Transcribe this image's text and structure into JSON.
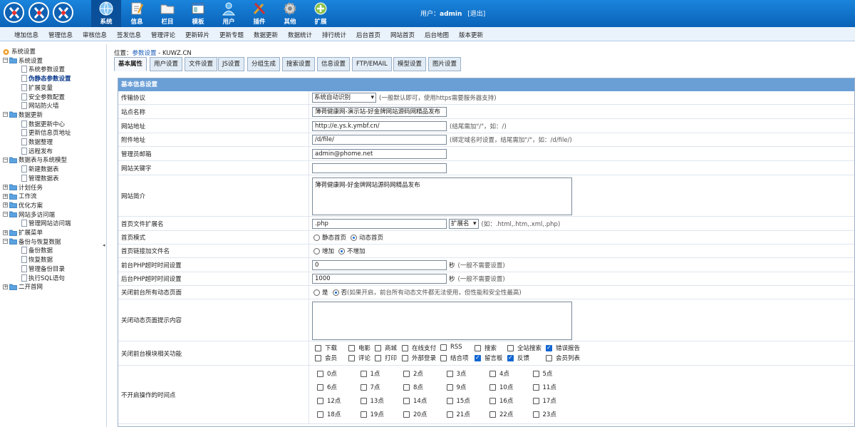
{
  "header": {
    "modules": [
      {
        "label": "系统",
        "icon": "globe-icon",
        "active": true
      },
      {
        "label": "信息",
        "icon": "document-pen-icon"
      },
      {
        "label": "栏目",
        "icon": "folder-icon"
      },
      {
        "label": "模板",
        "icon": "template-window-icon"
      },
      {
        "label": "用户",
        "icon": "user-icon"
      },
      {
        "label": "插件",
        "icon": "tools-icon"
      },
      {
        "label": "其他",
        "icon": "gear-icon"
      },
      {
        "label": "扩展",
        "icon": "plus-circle-icon"
      }
    ],
    "user_prefix": "用户：",
    "username": "admin",
    "logout": "[退出]"
  },
  "menu": [
    "增加信息",
    "管理信息",
    "审核信息",
    "签发信息",
    "管理评论",
    "更新碎片",
    "更新专题",
    "数据更新",
    "数据统计",
    "排行统计",
    "后台首页",
    "网站首页",
    "后台地图",
    "版本更新"
  ],
  "sidebar": {
    "nodes": [
      {
        "label": "系统设置",
        "level": 0,
        "type": "root"
      },
      {
        "label": "系统设置",
        "level": 1,
        "type": "folder"
      },
      {
        "label": "系统参数设置",
        "level": 2,
        "type": "page"
      },
      {
        "label": "伪静态参数设置",
        "level": 2,
        "type": "page",
        "current": true
      },
      {
        "label": "扩展变量",
        "level": 2,
        "type": "page"
      },
      {
        "label": "安全参数配置",
        "level": 2,
        "type": "page"
      },
      {
        "label": "网站防火墙",
        "level": 2,
        "type": "page"
      },
      {
        "label": "数据更新",
        "level": 1,
        "type": "folder"
      },
      {
        "label": "数据更新中心",
        "level": 2,
        "type": "page"
      },
      {
        "label": "更新信息页地址",
        "level": 2,
        "type": "page"
      },
      {
        "label": "数据整理",
        "level": 2,
        "type": "page"
      },
      {
        "label": "远程发布",
        "level": 2,
        "type": "page"
      },
      {
        "label": "数据表与系统模型",
        "level": 1,
        "type": "folder"
      },
      {
        "label": "新建数据表",
        "level": 2,
        "type": "page"
      },
      {
        "label": "管理数据表",
        "level": 2,
        "type": "page"
      },
      {
        "label": "计划任务",
        "level": 1,
        "type": "folder-closed"
      },
      {
        "label": "工作流",
        "level": 1,
        "type": "folder-closed"
      },
      {
        "label": "优化方案",
        "level": 1,
        "type": "folder-closed"
      },
      {
        "label": "网站多访问端",
        "level": 1,
        "type": "folder"
      },
      {
        "label": "管理网站访问端",
        "level": 2,
        "type": "page"
      },
      {
        "label": "扩展菜单",
        "level": 1,
        "type": "folder-closed"
      },
      {
        "label": "备份与恢复数据",
        "level": 1,
        "type": "folder"
      },
      {
        "label": "备份数据",
        "level": 2,
        "type": "page"
      },
      {
        "label": "恢复数据",
        "level": 2,
        "type": "page"
      },
      {
        "label": "管理备份目录",
        "level": 2,
        "type": "page"
      },
      {
        "label": "执行SQL语句",
        "level": 2,
        "type": "page"
      },
      {
        "label": "二开首网",
        "level": 1,
        "type": "folder-closed"
      }
    ],
    "collapse_glyph": "◂"
  },
  "breadcrumb": {
    "prefix": "位置：",
    "link": "参数设置",
    "suffix": " - KUWZ.CN"
  },
  "tabs": [
    "基本属性",
    "用户设置",
    "文件设置",
    "JS设置",
    "分组生成",
    "搜索设置",
    "信息设置",
    "FTP/EMAIL",
    "模型设置",
    "图片设置"
  ],
  "form": {
    "section_title": "基本信息设置",
    "protocol": {
      "label": "传输协议",
      "value": "系统自动识别",
      "hint": "(一般默认即可，使用https需要服务器支持)"
    },
    "sitename": {
      "label": "站点名称",
      "value": "薄荷健康网-演示站-好金牌网站源码网精品发布"
    },
    "siteurl": {
      "label": "网站地址",
      "value": "http://e.ys.k.ymbf.cn/",
      "hint": "(结尾需加\"/\"，如：/)"
    },
    "attach": {
      "label": "附件地址",
      "value": "/d/file/",
      "hint": "(绑定域名时设置，结尾需加\"/\"，如：/d/file/)"
    },
    "email": {
      "label": "管理员邮箱",
      "value": "admin@phome.net"
    },
    "keywords": {
      "label": "网站关键字",
      "value": ""
    },
    "intro": {
      "label": "网站简介",
      "value": "薄荷健康网-好金牌网站源码网精品发布"
    },
    "ext": {
      "label": "首页文件扩展名",
      "value": ".php",
      "select": "扩展名",
      "hint": "(如：.html,.htm,.xml,.php)"
    },
    "homemode": {
      "label": "首页模式",
      "opt1": "静态首页",
      "opt2": "动态首页"
    },
    "homelink": {
      "label": "首页链接加文件名",
      "opt1": "增加",
      "opt2": "不增加"
    },
    "fronttimeout": {
      "label": "前台PHP超时时间设置",
      "value": "0",
      "unit": "秒",
      "hint": "(一般不需要设置)"
    },
    "backtimeout": {
      "label": "后台PHP超时时间设置",
      "value": "1000",
      "unit": "秒",
      "hint": "(一般不需要设置)"
    },
    "closedyn": {
      "label": "关闭前台所有动态页面",
      "opt1": "是",
      "opt2": "否",
      "hint": "(如果开启，前台所有动态文件都无法使用，但性能和安全性最高)"
    },
    "closetip": {
      "label": "关闭动态页面提示内容",
      "value": ""
    },
    "modules": {
      "label": "关闭前台模块相关功能",
      "items": [
        {
          "label": "下载",
          "checked": false
        },
        {
          "label": "电影",
          "checked": false
        },
        {
          "label": "商城",
          "checked": false
        },
        {
          "label": "在线支付",
          "checked": false
        },
        {
          "label": "RSS",
          "checked": false
        },
        {
          "label": "搜索",
          "checked": false
        },
        {
          "label": "全站搜索",
          "checked": false
        },
        {
          "label": "错误报告",
          "checked": true
        },
        {
          "label": "会员",
          "checked": false
        },
        {
          "label": "评论",
          "checked": false
        },
        {
          "label": "打印",
          "checked": false
        },
        {
          "label": "外部登录",
          "checked": false
        },
        {
          "label": "结合项",
          "checked": false
        },
        {
          "label": "留言板",
          "checked": true
        },
        {
          "label": "反馈",
          "checked": true
        },
        {
          "label": "会员列表",
          "checked": false
        }
      ]
    },
    "hours": {
      "label": "不开启操作的时间点",
      "items": [
        "0点",
        "1点",
        "2点",
        "3点",
        "4点",
        "5点",
        "6点",
        "7点",
        "8点",
        "9点",
        "10点",
        "11点",
        "12点",
        "13点",
        "14点",
        "15点",
        "16点",
        "17点",
        "18点",
        "19点",
        "20点",
        "21点",
        "22点",
        "23点"
      ]
    }
  }
}
